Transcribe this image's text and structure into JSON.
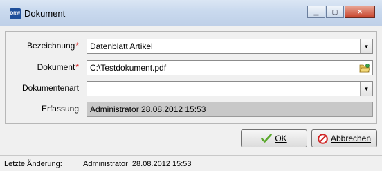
{
  "window": {
    "title": "Dokument",
    "app_icon_text": "DRW"
  },
  "form": {
    "bezeichnung": {
      "label": "Bezeichnung",
      "value": "Datenblatt Artikel",
      "required": true
    },
    "dokument": {
      "label": "Dokument",
      "value": "C:\\Testdokument.pdf",
      "required": true
    },
    "dokumentenart": {
      "label": "Dokumentenart",
      "value": ""
    },
    "erfassung": {
      "label": "Erfassung",
      "value": "Administrator 28.08.2012 15:53"
    }
  },
  "buttons": {
    "ok_label": "OK",
    "cancel_label": "Abbrechen"
  },
  "statusbar": {
    "label": "Letzte Änderung:",
    "value": "Administrator  28.08.2012 15:53"
  },
  "colors": {
    "required_marker": "#d42020",
    "readonly_field": "#c8c8c8"
  }
}
